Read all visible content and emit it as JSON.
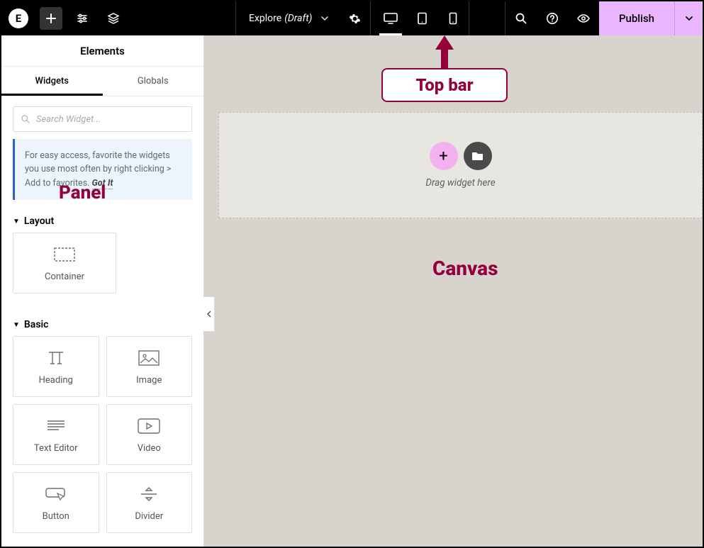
{
  "topbar": {
    "logo_letter": "E",
    "title_name": "Explore",
    "title_status": "(Draft)",
    "publish_label": "Publish"
  },
  "panel": {
    "title": "Elements",
    "tabs": {
      "widgets": "Widgets",
      "globals": "Globals"
    },
    "search_placeholder": "Search Widget...",
    "tip_text": "For easy access, favorite the widgets you use most often by right clicking > Add to favorites.",
    "tip_gotit": "Got It",
    "sections": {
      "layout": {
        "label": "Layout",
        "items": {
          "container": "Container"
        }
      },
      "basic": {
        "label": "Basic",
        "items": {
          "heading": "Heading",
          "image": "Image",
          "text_editor": "Text Editor",
          "video": "Video",
          "button": "Button",
          "divider": "Divider"
        }
      }
    }
  },
  "canvas": {
    "drop_hint": "Drag widget here"
  },
  "annotations": {
    "topbar": "Top bar",
    "panel": "Panel",
    "canvas": "Canvas"
  }
}
